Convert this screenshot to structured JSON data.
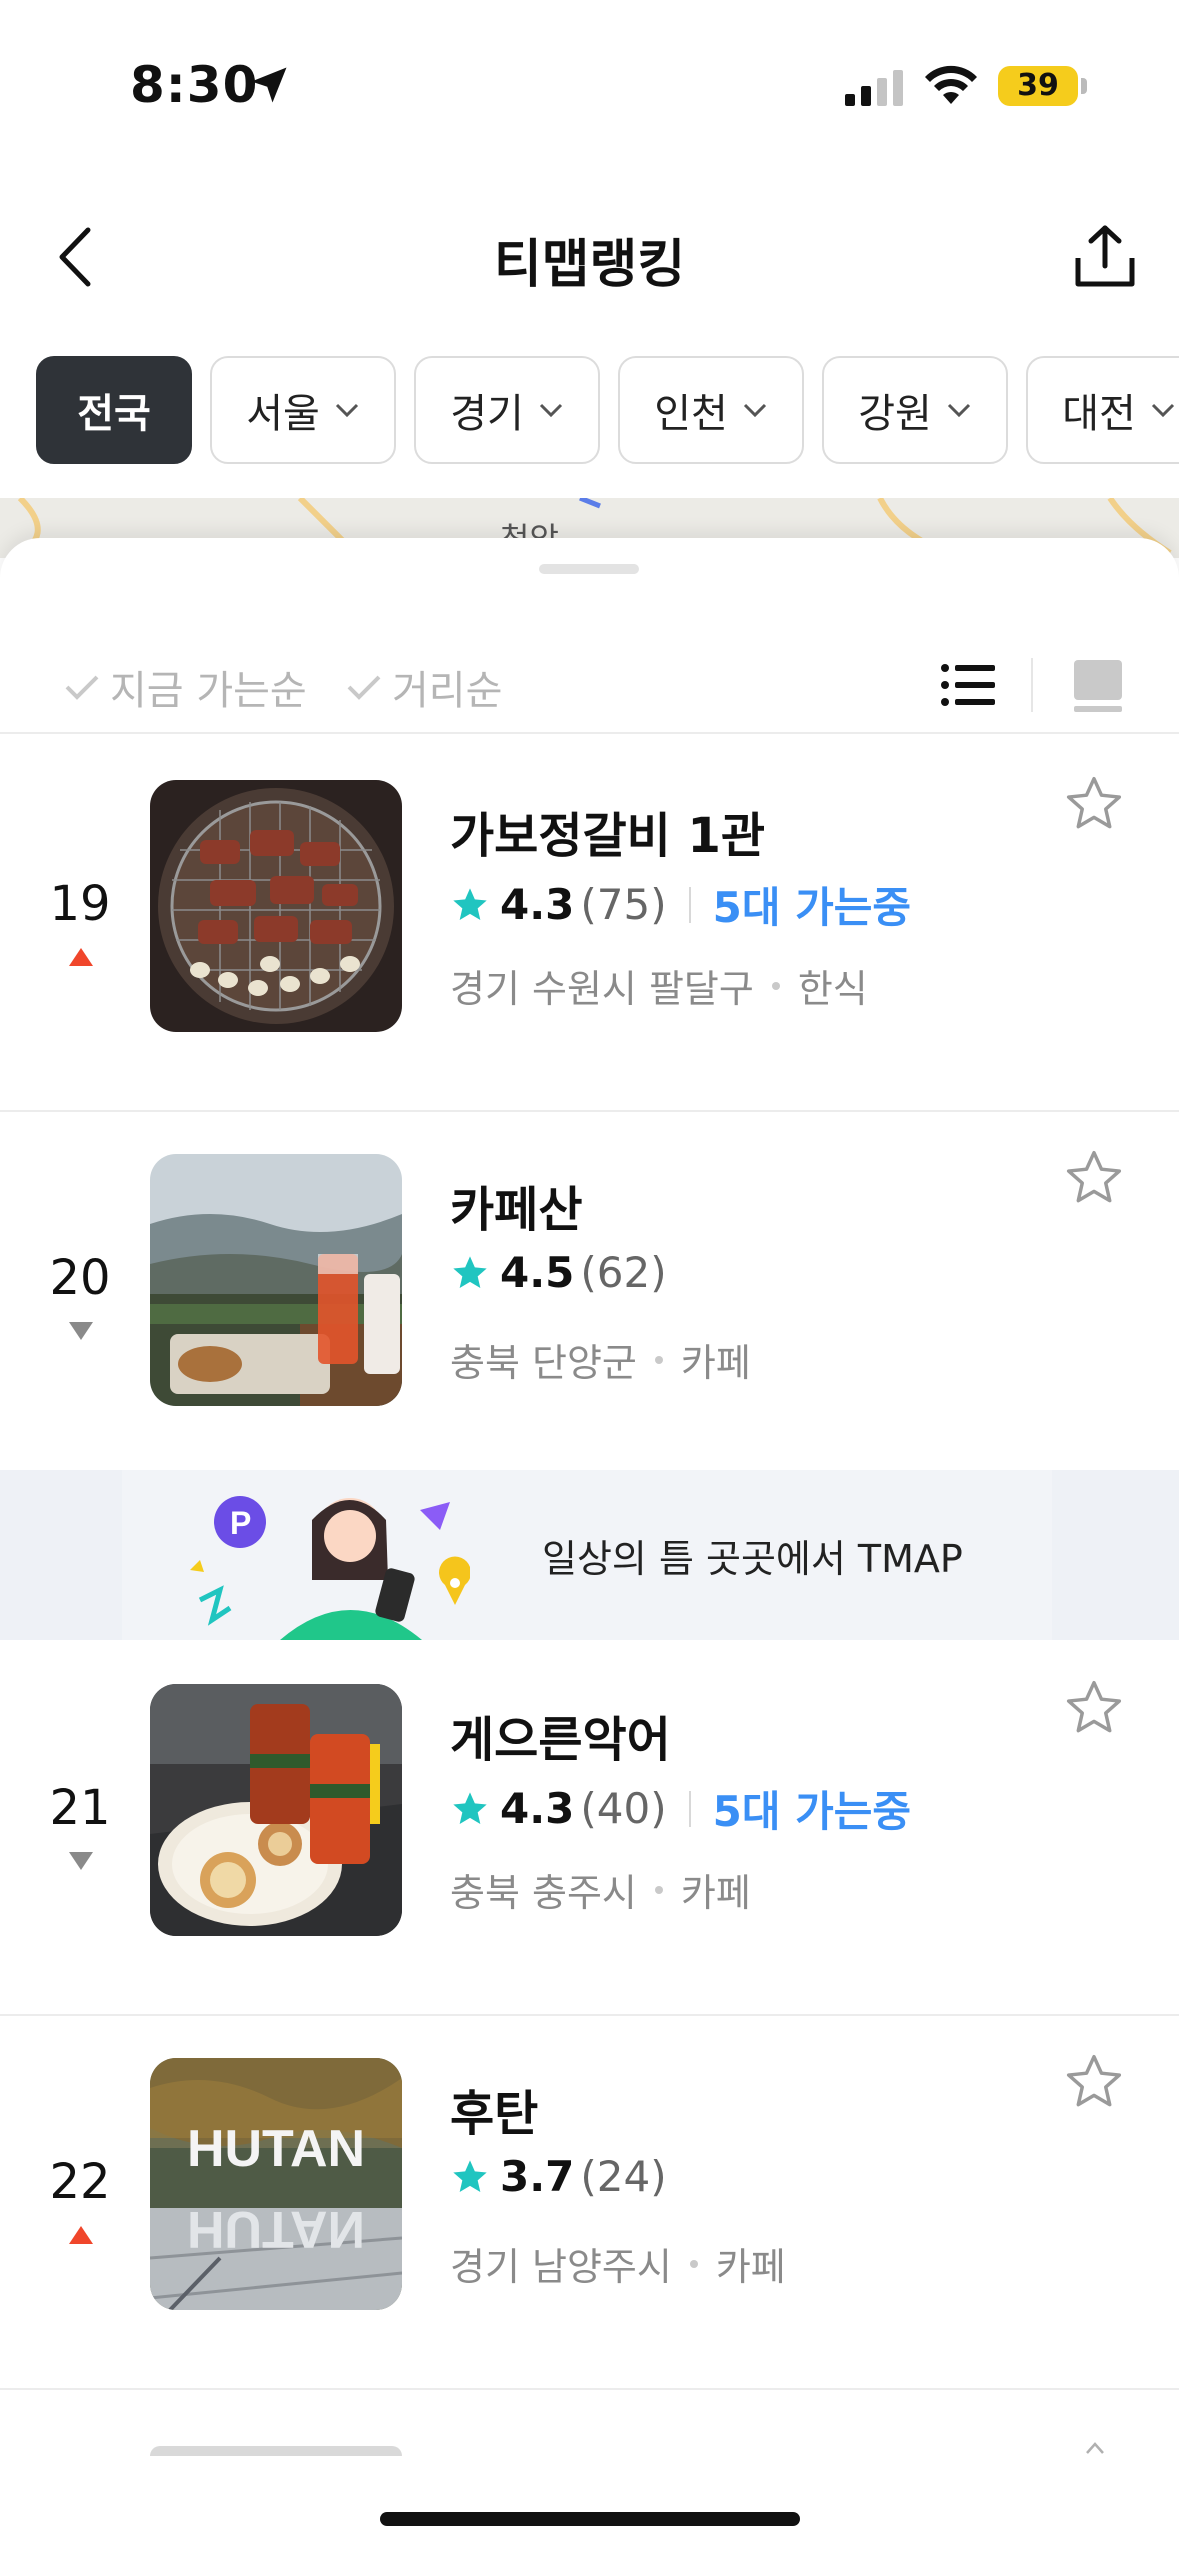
{
  "status_bar": {
    "time": "8:30",
    "battery": "39"
  },
  "nav": {
    "title": "티맵랭킹"
  },
  "regions": [
    {
      "label": "전국",
      "active": true
    },
    {
      "label": "서울",
      "active": false
    },
    {
      "label": "경기",
      "active": false
    },
    {
      "label": "인천",
      "active": false
    },
    {
      "label": "강원",
      "active": false
    },
    {
      "label": "대전",
      "active": false
    }
  ],
  "map": {
    "label": "청암"
  },
  "sort": {
    "option1": "지금 가는순",
    "option2": "거리순"
  },
  "items": [
    {
      "rank": "19",
      "trend": "up",
      "name": "가보정갈비 1관",
      "score": "4.3",
      "reviews": "(75)",
      "going": "5대 가는중",
      "region": "경기 수원시 팔달구",
      "category": "한식"
    },
    {
      "rank": "20",
      "trend": "down",
      "name": "카페산",
      "score": "4.5",
      "reviews": "(62)",
      "going": "",
      "region": "충북 단양군",
      "category": "카페"
    },
    {
      "rank": "21",
      "trend": "down",
      "name": "게으른악어",
      "score": "4.3",
      "reviews": "(40)",
      "going": "5대 가는중",
      "region": "충북 충주시",
      "category": "카페"
    },
    {
      "rank": "22",
      "trend": "up",
      "name": "후탄",
      "score": "3.7",
      "reviews": "(24)",
      "going": "",
      "region": "경기 남양주시",
      "category": "카페",
      "thumb_text": "HUTAN"
    }
  ],
  "ad": {
    "text": "일상의 틈 곳곳에서 TMAP"
  },
  "colors": {
    "accent_blue": "#3a8ff5",
    "star_teal": "#20c5c0",
    "trend_up": "#f0462b",
    "trend_down": "#8a8a8a",
    "chip_active": "#2f3338",
    "battery": "#f5cc1c"
  }
}
